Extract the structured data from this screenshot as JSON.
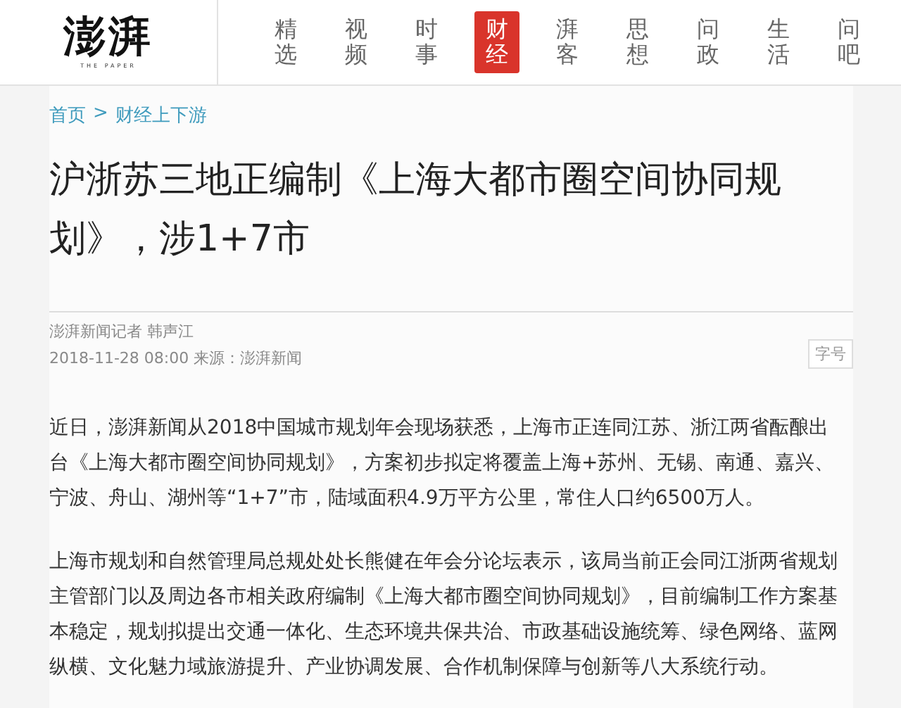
{
  "logo": {
    "text": "澎湃",
    "subtitle": "THE PAPER"
  },
  "nav": [
    {
      "label": "精选",
      "selected": false
    },
    {
      "label": "视频",
      "selected": false
    },
    {
      "label": "时事",
      "selected": false
    },
    {
      "label": "财经",
      "selected": true
    },
    {
      "label": "湃客",
      "selected": false
    },
    {
      "label": "思想",
      "selected": false
    },
    {
      "label": "问政",
      "selected": false
    },
    {
      "label": "生活",
      "selected": false
    },
    {
      "label": "问吧",
      "selected": false
    }
  ],
  "breadcrumb": {
    "home": "首页",
    "separator": ">",
    "current": "财经上下游"
  },
  "article": {
    "title": "沪浙苏三地正编制《上海大都市圈空间协同规划》，涉1+7市",
    "author": "澎湃新闻记者 韩声江",
    "meta": "2018-11-28 08:00 来源：澎湃新闻",
    "font_button": "字号",
    "paragraphs": [
      "近日，澎湃新闻从2018中国城市规划年会现场获悉，上海市正连同江苏、浙江两省酝酿出台《上海大都市圈空间协同规划》，方案初步拟定将覆盖上海+苏州、无锡、南通、嘉兴、宁波、舟山、湖州等“1+7”市，陆域面积4.9万平方公里，常住人口约6500万人。",
      "上海市规划和自然管理局总规处处长熊健在年会分论坛表示，该局当前正会同江浙两省规划主管部门以及周边各市相关政府编制《上海大都市圈空间协同规划》，目前编制工作方案基本稳定，规划拟提出交通一体化、生态环境共保共治、市政基础设施统筹、绿色网络、蓝网纵横、文化魅力域旅游提升、产业协调发展、合作机制保障与创新等八大系统行动。"
    ]
  }
}
